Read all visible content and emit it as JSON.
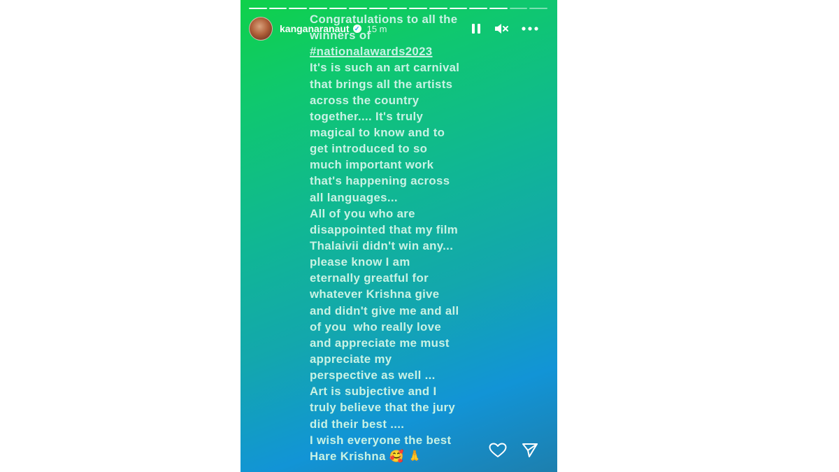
{
  "story": {
    "segments_total": 15,
    "segments_viewed": 13,
    "user": {
      "username": "kanganaranaut",
      "verified": true,
      "time_ago": "15 m"
    },
    "controls": {
      "pause_icon": "pause-icon",
      "mute_icon": "muted-speaker-icon",
      "more_icon": "more-options-icon"
    },
    "text_lines": [
      "Congratulations to all the",
      "winners of",
      "#nationalawards2023",
      "It's is such an art carnival",
      "that brings all the artists",
      "across the country",
      "together.... It's truly",
      "magical to know and to",
      "get introduced to so",
      "much important work",
      "that's happening across",
      "all languages...",
      "All of you who are",
      "disappointed that my film",
      "Thalaivii didn't win any...",
      "please know I am",
      "eternally greatful for",
      "whatever Krishna give",
      "and didn't give me and all",
      "of you  who really love",
      "and appreciate me must",
      "appreciate my",
      "perspective as well ...",
      "Art is subjective and I",
      "truly believe that the jury",
      "did their best ....",
      "I wish everyone the best",
      "Hare Krishna 🥰 🙏"
    ],
    "footer": {
      "like_icon": "heart-icon",
      "share_icon": "send-icon"
    },
    "colors": {
      "gradient_top": "#0fd14a",
      "gradient_mid": "#10b793",
      "gradient_bottom": "#1294d6",
      "text": "#c9f2e4"
    }
  }
}
